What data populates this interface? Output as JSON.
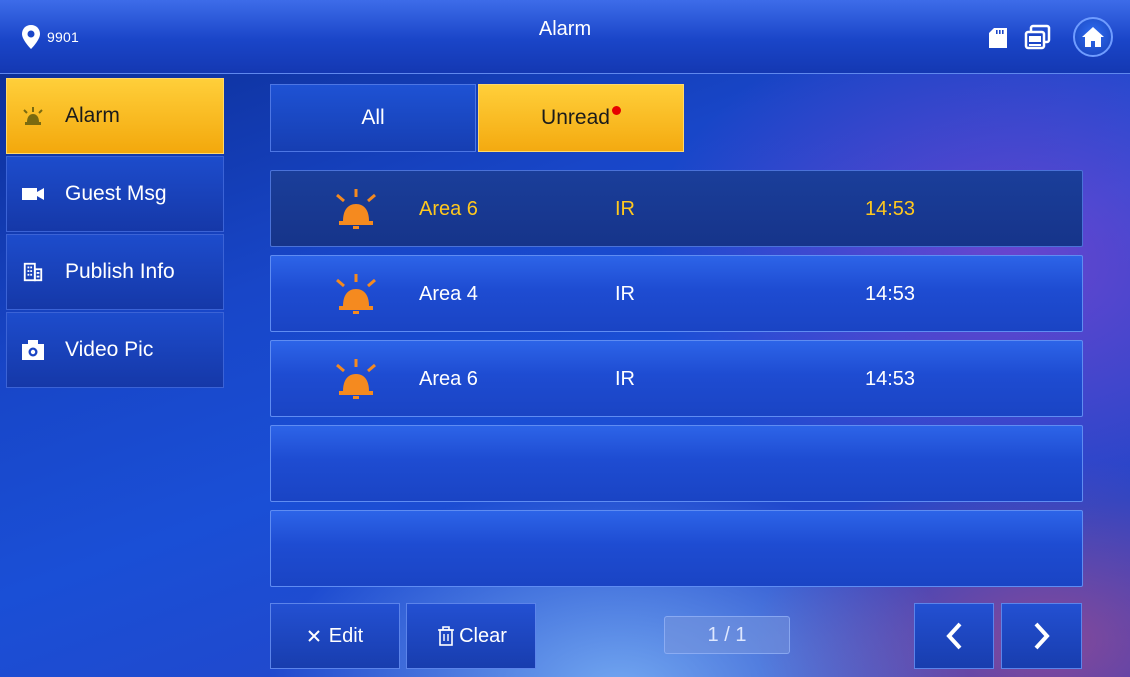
{
  "header": {
    "location_id": "9901",
    "title": "Alarm",
    "icons": [
      "location-pin-icon",
      "sd-card-icon",
      "network-icon",
      "home-icon"
    ]
  },
  "sidebar": {
    "items": [
      {
        "label": "Alarm",
        "icon": "alarm-icon",
        "active": true
      },
      {
        "label": "Guest Msg",
        "icon": "camera-icon",
        "active": false
      },
      {
        "label": "Publish Info",
        "icon": "building-icon",
        "active": false
      },
      {
        "label": "Video Pic",
        "icon": "photo-camera-icon",
        "active": false
      }
    ]
  },
  "tabs": [
    {
      "label": "All",
      "active": false
    },
    {
      "label": "Unread",
      "active": true,
      "badge": "red-dot"
    }
  ],
  "alarms": [
    {
      "area": "Area 6",
      "type": "IR",
      "time": "14:53",
      "selected": true
    },
    {
      "area": "Area 4",
      "type": "IR",
      "time": "14:53",
      "selected": false
    },
    {
      "area": "Area 6",
      "type": "IR",
      "time": "14:53",
      "selected": false
    }
  ],
  "footer": {
    "edit_label": "Edit",
    "clear_label": "Clear",
    "page_indicator": "1 / 1"
  },
  "colors": {
    "accent_yellow": "#f4aa10",
    "selected_text": "#ffc81e",
    "bell_orange": "#f58a1f",
    "unread_dot": "#e60000"
  }
}
